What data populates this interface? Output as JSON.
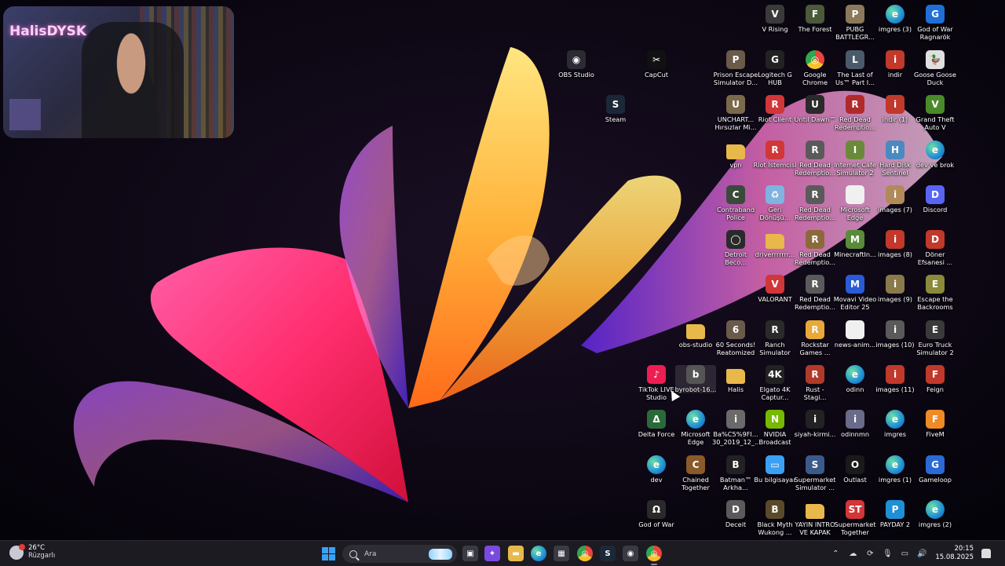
{
  "webcam": {
    "label": "HalisDYSK"
  },
  "desktop_icons": [
    {
      "label": "V Rising",
      "icon": "v-rising-icon",
      "color": "#3a3a3a",
      "glyph": "V"
    },
    {
      "label": "The Forest",
      "icon": "the-forest-icon",
      "color": "#4a5a3a",
      "glyph": "F"
    },
    {
      "label": "PUBG\nBATTLEGR...",
      "icon": "pubg-icon",
      "color": "#8a7a5a",
      "glyph": "P"
    },
    {
      "label": "imgres (3)",
      "icon": "edge-icon",
      "color": "#1f8fd6",
      "glyph": "e"
    },
    {
      "label": "God of War\nRagnarök",
      "icon": "god-of-war-ragnarok-icon",
      "color": "#1f6fd6",
      "glyph": "G"
    },
    {
      "label": "OBS Studio",
      "icon": "obs-studio-icon",
      "color": "#2b2b33",
      "glyph": "◉"
    },
    {
      "label": "CapCut",
      "icon": "capcut-icon",
      "color": "#111111",
      "glyph": "✂"
    },
    {
      "label": "Prison Escape\nSimulator D...",
      "icon": "prison-escape-icon",
      "color": "#6a5a4a",
      "glyph": "P"
    },
    {
      "label": "Logitech G\nHUB",
      "icon": "logitech-g-hub-icon",
      "color": "#222222",
      "glyph": "G"
    },
    {
      "label": "Google\nChrome",
      "icon": "chrome-icon",
      "color": "#e8453c",
      "glyph": "◎"
    },
    {
      "label": "The Last of\nUs™ Part I...",
      "icon": "last-of-us-icon",
      "color": "#4a5a6a",
      "glyph": "L"
    },
    {
      "label": "indir",
      "icon": "image-file-icon",
      "color": "#c0392b",
      "glyph": "i"
    },
    {
      "label": "Goose Goose\nDuck",
      "icon": "goose-goose-duck-icon",
      "color": "#e0e0e0",
      "glyph": "🦆"
    },
    {
      "label": "Steam",
      "icon": "steam-icon",
      "color": "#1b2838",
      "glyph": "S"
    },
    {
      "label": "UNCHART...\nHırsızlar Mi...",
      "icon": "uncharted-icon",
      "color": "#7a6a4a",
      "glyph": "U"
    },
    {
      "label": "Riot Client",
      "icon": "riot-client-icon",
      "color": "#d13639",
      "glyph": "R"
    },
    {
      "label": "Until Dawn™",
      "icon": "until-dawn-icon",
      "color": "#2a2a2a",
      "glyph": "U"
    },
    {
      "label": "Red Dead\nRedemptio...",
      "icon": "red-dead-icon",
      "color": "#b02a2a",
      "glyph": "R"
    },
    {
      "label": "indir (1)",
      "icon": "image-file-icon",
      "color": "#c0392b",
      "glyph": "i"
    },
    {
      "label": "Grand Theft\nAuto V",
      "icon": "gta-v-icon",
      "color": "#4a8a2a",
      "glyph": "V"
    },
    {
      "label": "vpn",
      "icon": "folder-icon",
      "color": "#e8b84a",
      "glyph": ""
    },
    {
      "label": "Riot İstemcisi",
      "icon": "riot-client-icon",
      "color": "#d13639",
      "glyph": "R"
    },
    {
      "label": "Red Dead\nRedemptio...",
      "icon": "red-dead-icon",
      "color": "#5a5a5a",
      "glyph": "R"
    },
    {
      "label": "Internet Cafe\nSimulator 2",
      "icon": "internet-cafe-icon",
      "color": "#6a8a3a",
      "glyph": "I"
    },
    {
      "label": "Hard Disk\nSentinel",
      "icon": "hard-disk-sentinel-icon",
      "color": "#4a8ac0",
      "glyph": "H"
    },
    {
      "label": "dev ve brok",
      "icon": "edge-icon",
      "color": "#1f8fd6",
      "glyph": "e"
    },
    {
      "label": "Contraband\nPolice",
      "icon": "contraband-police-icon",
      "color": "#3a4a3a",
      "glyph": "C"
    },
    {
      "label": "Geri\nDönüşü...",
      "icon": "recycle-bin-icon",
      "color": "#7fb3e0",
      "glyph": "♻"
    },
    {
      "label": "Red Dead\nRedemptio...",
      "icon": "red-dead-icon",
      "color": "#5a5a5a",
      "glyph": "R"
    },
    {
      "label": "Microsoft\nEdge",
      "icon": "document-icon",
      "color": "#f0f0f0",
      "glyph": ""
    },
    {
      "label": "images (7)",
      "icon": "image-file-icon",
      "color": "#b08a5a",
      "glyph": "i"
    },
    {
      "label": "Discord",
      "icon": "discord-icon",
      "color": "#5865f2",
      "glyph": "D"
    },
    {
      "label": "Detroit\nBeco...",
      "icon": "detroit-icon",
      "color": "#2a2a2a",
      "glyph": "◯"
    },
    {
      "label": "driverrrrrrr...",
      "icon": "folder-icon",
      "color": "#e8b84a",
      "glyph": ""
    },
    {
      "label": "Red Dead\nRedemptio...",
      "icon": "red-dead-icon",
      "color": "#8a6a3a",
      "glyph": "R"
    },
    {
      "label": "MinecraftIn...",
      "icon": "minecraft-icon",
      "color": "#5a8a3a",
      "glyph": "M"
    },
    {
      "label": "images (8)",
      "icon": "image-file-icon",
      "color": "#c0392b",
      "glyph": "i"
    },
    {
      "label": "Döner\nEfsanesi ...",
      "icon": "doner-efsanesi-icon",
      "color": "#c0392b",
      "glyph": "D"
    },
    {
      "label": "VALORANT",
      "icon": "valorant-icon",
      "color": "#d13639",
      "glyph": "V"
    },
    {
      "label": "Red Dead\nRedemptio...",
      "icon": "red-dead-icon",
      "color": "#5a5a5a",
      "glyph": "R"
    },
    {
      "label": "Movavi Video\nEditor 25",
      "icon": "movavi-icon",
      "color": "#2a5ad6",
      "glyph": "M"
    },
    {
      "label": "images (9)",
      "icon": "image-file-icon",
      "color": "#8a7a4a",
      "glyph": "i"
    },
    {
      "label": "Escape the\nBackrooms",
      "icon": "escape-backrooms-icon",
      "color": "#8a8a3a",
      "glyph": "E"
    },
    {
      "label": "obs-studio",
      "icon": "folder-icon",
      "color": "#e8b84a",
      "glyph": ""
    },
    {
      "label": "60 Seconds!\nReatomized",
      "icon": "sixty-seconds-icon",
      "color": "#6a5a4a",
      "glyph": "6"
    },
    {
      "label": "Ranch\nSimulator",
      "icon": "ranch-simulator-icon",
      "color": "#2a2a2a",
      "glyph": "R"
    },
    {
      "label": "Rockstar\nGames ...",
      "icon": "rockstar-icon",
      "color": "#e8a83a",
      "glyph": "R"
    },
    {
      "label": "news-anim...",
      "icon": "document-icon",
      "color": "#f0f0f0",
      "glyph": ""
    },
    {
      "label": "images (10)",
      "icon": "image-file-icon",
      "color": "#5a5a5a",
      "glyph": "i"
    },
    {
      "label": "Euro Truck\nSimulator 2",
      "icon": "euro-truck-icon",
      "color": "#3a3a3a",
      "glyph": "E"
    },
    {
      "label": "TikTok LIVE\nStudio",
      "icon": "tiktok-live-icon",
      "color": "#ee1d52",
      "glyph": "♪"
    },
    {
      "label": "byrobot-16...",
      "icon": "byrobot-icon",
      "color": "#555555",
      "glyph": "b"
    },
    {
      "label": "Halis",
      "icon": "folder-icon",
      "color": "#e8b84a",
      "glyph": ""
    },
    {
      "label": "Elgato 4K\nCaptur...",
      "icon": "elgato-icon",
      "color": "#222222",
      "glyph": "4K"
    },
    {
      "label": "Rust -\nStagi...",
      "icon": "rust-icon",
      "color": "#b03a2a",
      "glyph": "R"
    },
    {
      "label": "odinn",
      "icon": "edge-icon",
      "color": "#1f8fd6",
      "glyph": "e"
    },
    {
      "label": "images (11)",
      "icon": "image-file-icon",
      "color": "#c0392b",
      "glyph": "i"
    },
    {
      "label": "Feign",
      "icon": "feign-icon",
      "color": "#c0392b",
      "glyph": "F"
    },
    {
      "label": "Delta Force",
      "icon": "delta-force-icon",
      "color": "#2a6a3a",
      "glyph": "Δ"
    },
    {
      "label": "Microsoft\nEdge",
      "icon": "edge-icon",
      "color": "#1f8fd6",
      "glyph": "e"
    },
    {
      "label": "Ba%C5%9FI...\n30_2019_12_...",
      "icon": "image-file-icon",
      "color": "#6a6a6a",
      "glyph": "i"
    },
    {
      "label": "NVIDIA\nBroadcast",
      "icon": "nvidia-broadcast-icon",
      "color": "#76b900",
      "glyph": "N"
    },
    {
      "label": "siyah-kirmi...",
      "icon": "image-file-icon",
      "color": "#222222",
      "glyph": "i"
    },
    {
      "label": "odinnmn",
      "icon": "image-file-icon",
      "color": "#6a6a8a",
      "glyph": "i"
    },
    {
      "label": "imgres",
      "icon": "edge-icon",
      "color": "#1f8fd6",
      "glyph": "e"
    },
    {
      "label": "FiveM",
      "icon": "fivem-icon",
      "color": "#f08a24",
      "glyph": "F"
    },
    {
      "label": "dev",
      "icon": "edge-icon",
      "color": "#1f8fd6",
      "glyph": "e"
    },
    {
      "label": "Chained\nTogether",
      "icon": "chained-together-icon",
      "color": "#8a5a2a",
      "glyph": "C"
    },
    {
      "label": "Batman™\nArkha...",
      "icon": "batman-icon",
      "color": "#222222",
      "glyph": "B"
    },
    {
      "label": "Bu bilgisayar",
      "icon": "this-pc-icon",
      "color": "#3aa0f5",
      "glyph": "▭"
    },
    {
      "label": "Supermarket\nSimulator ...",
      "icon": "supermarket-simulator-icon",
      "color": "#3a5a8a",
      "glyph": "S"
    },
    {
      "label": "Outlast",
      "icon": "outlast-icon",
      "color": "#1a1a1a",
      "glyph": "O"
    },
    {
      "label": "imgres (1)",
      "icon": "edge-icon",
      "color": "#1f8fd6",
      "glyph": "e"
    },
    {
      "label": "Gameloop",
      "icon": "gameloop-icon",
      "color": "#2a6ad6",
      "glyph": "G"
    },
    {
      "label": "God of War",
      "icon": "god-of-war-icon",
      "color": "#2a2a2a",
      "glyph": "Ω"
    },
    {
      "label": "Deceit",
      "icon": "deceit-icon",
      "color": "#5a5a5a",
      "glyph": "D"
    },
    {
      "label": "Black Myth\nWukong ...",
      "icon": "black-myth-icon",
      "color": "#5a4a2a",
      "glyph": "B"
    },
    {
      "label": "YAYIN INTRO\nVE KAPAK",
      "icon": "folder-icon",
      "color": "#e8b84a",
      "glyph": ""
    },
    {
      "label": "Supermarket\nTogether",
      "icon": "supermarket-together-icon",
      "color": "#d13639",
      "glyph": "ST"
    },
    {
      "label": "PAYDAY 2",
      "icon": "payday-2-icon",
      "color": "#1f8fd6",
      "glyph": "P"
    },
    {
      "label": "imgres (2)",
      "icon": "edge-icon",
      "color": "#1f8fd6",
      "glyph": "e"
    }
  ],
  "taskbar": {
    "weather_temp": "26°C",
    "weather_desc": "Rüzgarlı",
    "search_placeholder": "Ara",
    "pinned": [
      {
        "name": "task-view-icon",
        "color": "#3a3a44",
        "glyph": "▣"
      },
      {
        "name": "copilot-icon",
        "color": "#7a4ae0",
        "glyph": "✦"
      },
      {
        "name": "file-explorer-icon",
        "color": "#e8b84a",
        "glyph": "▬"
      },
      {
        "name": "edge-icon",
        "color": "#1f8fd6",
        "glyph": "e"
      },
      {
        "name": "microsoft-store-icon",
        "color": "#3a3a44",
        "glyph": "▦"
      },
      {
        "name": "chrome-icon",
        "color": "#e8453c",
        "glyph": "◎"
      },
      {
        "name": "steam-icon",
        "color": "#1b2838",
        "glyph": "S"
      },
      {
        "name": "obs-icon",
        "color": "#3a3a44",
        "glyph": "◉"
      },
      {
        "name": "chrome-active-icon",
        "color": "#e8453c",
        "glyph": "◎"
      }
    ],
    "time": "20:15",
    "date": "15.08.2025"
  }
}
